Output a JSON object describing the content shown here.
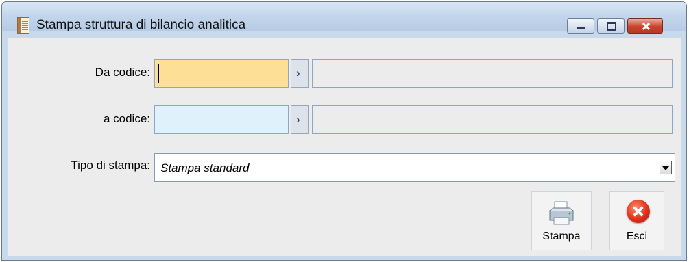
{
  "window": {
    "title": "Stampa struttura di bilancio analitica",
    "icons": {
      "app": "report-document-icon",
      "minimize": "minimize-icon",
      "maximize": "maximize-icon",
      "close": "close-icon"
    }
  },
  "form": {
    "da_codice": {
      "label": "Da codice:",
      "value": "",
      "description": "",
      "zoom_symbol": "›",
      "color": "#fddf96"
    },
    "a_codice": {
      "label": "a codice:",
      "value": "",
      "description": "",
      "zoom_symbol": "›",
      "color": "#dff2fc"
    },
    "tipo_stampa": {
      "label": "Tipo di stampa:",
      "selected": "Stampa standard"
    }
  },
  "buttons": {
    "stampa": {
      "label": "Stampa",
      "icon": "printer-icon"
    },
    "esci": {
      "label": "Esci",
      "icon": "exit-icon"
    }
  }
}
